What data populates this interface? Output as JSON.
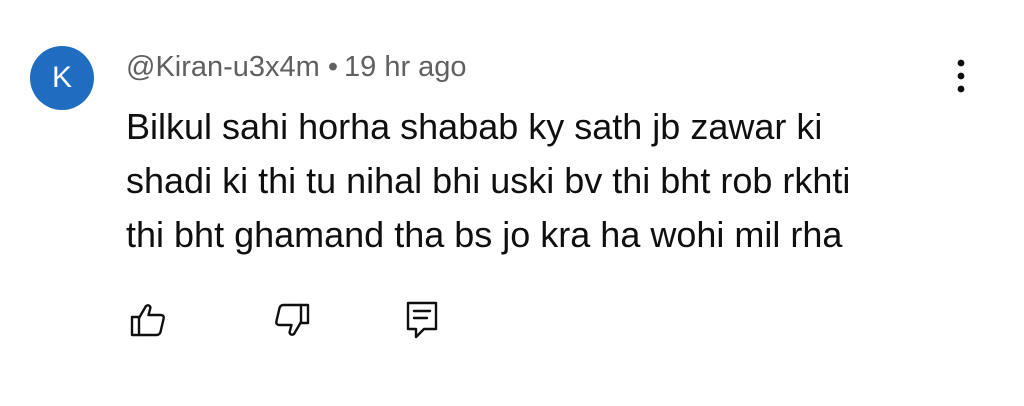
{
  "comment": {
    "avatar": {
      "initial": "K",
      "color": "#1f6cc0"
    },
    "author": "@Kiran-u3x4m",
    "separator": "•",
    "timestamp": "19 hr ago",
    "lines": [
      "Bilkul sahi horha shabab ky sath jb zawar ki",
      "shadi ki thi tu nihal bhi uski bv thi bht rob rkhti",
      "thi bht ghamand tha bs jo kra ha wohi mil rha"
    ],
    "actions": {
      "like": "thumbs-up-icon",
      "dislike": "thumbs-down-icon",
      "reply": "reply-comment-icon",
      "more": "more-vertical-icon"
    }
  }
}
